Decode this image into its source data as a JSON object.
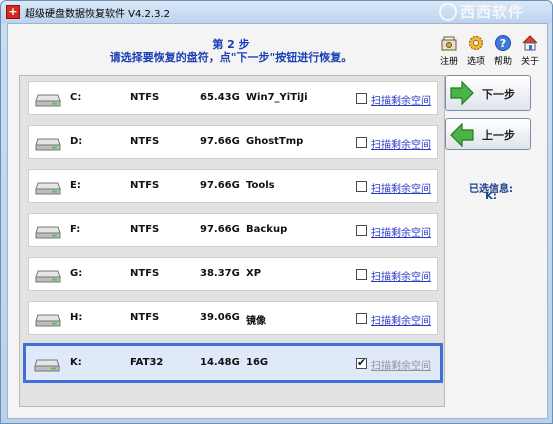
{
  "window": {
    "app_icon_glyph": "+",
    "title": "超级硬盘数据恢复软件 V4.2.3.2",
    "watermark": "西西软件"
  },
  "header": {
    "step": "第 2 步",
    "instruction": "请选择要恢复的盘符，点\"下一步\"按钮进行恢复。"
  },
  "toolbar": [
    {
      "label": "注册",
      "icon": "register-icon"
    },
    {
      "label": "选项",
      "icon": "gear-icon"
    },
    {
      "label": "帮助",
      "icon": "help-icon"
    },
    {
      "label": "关于",
      "icon": "home-icon"
    }
  ],
  "drives": [
    {
      "letter": "C:",
      "fs": "NTFS",
      "size": "65.43G",
      "label": "Win7_YiTiJi",
      "scan_label": "扫描剩余空间",
      "checked": false,
      "selected": false
    },
    {
      "letter": "D:",
      "fs": "NTFS",
      "size": "97.66G",
      "label": "GhostTmp",
      "scan_label": "扫描剩余空间",
      "checked": false,
      "selected": false
    },
    {
      "letter": "E:",
      "fs": "NTFS",
      "size": "97.66G",
      "label": "Tools",
      "scan_label": "扫描剩余空间",
      "checked": false,
      "selected": false
    },
    {
      "letter": "F:",
      "fs": "NTFS",
      "size": "97.66G",
      "label": "Backup",
      "scan_label": "扫描剩余空间",
      "checked": false,
      "selected": false
    },
    {
      "letter": "G:",
      "fs": "NTFS",
      "size": "38.37G",
      "label": "XP",
      "scan_label": "扫描剩余空间",
      "checked": false,
      "selected": false
    },
    {
      "letter": "H:",
      "fs": "NTFS",
      "size": "39.06G",
      "label": "镜像",
      "scan_label": "扫描剩余空间",
      "checked": false,
      "selected": false
    },
    {
      "letter": "K:",
      "fs": "FAT32",
      "size": "14.48G",
      "label": "16G",
      "scan_label": "扫描剩余空间",
      "checked": true,
      "selected": true
    }
  ],
  "buttons": {
    "next_label": "下一步",
    "prev_label": "上一步"
  },
  "selection": {
    "info_label": "已选信息:",
    "value": "K:"
  },
  "colors": {
    "accent": "#1a3fb5",
    "selected_border": "#3f6fd8",
    "link": "#2b39c9",
    "arrow_green": "#3aa53a"
  }
}
